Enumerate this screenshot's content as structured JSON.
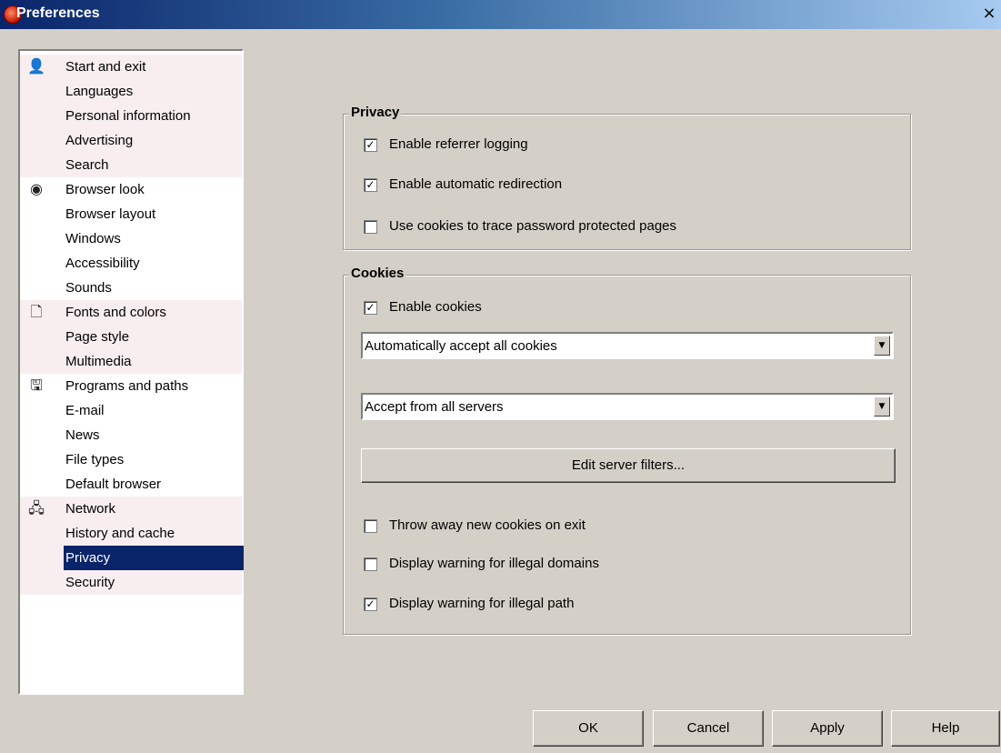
{
  "window": {
    "title": "Preferences",
    "close_glyph": "×"
  },
  "sidebar": {
    "items": [
      {
        "label": "Start and exit",
        "icon": "person-icon",
        "glyph": "👤"
      },
      {
        "label": "Languages"
      },
      {
        "label": "Personal information"
      },
      {
        "label": "Advertising"
      },
      {
        "label": "Search"
      },
      {
        "label": "Browser look",
        "icon": "eye-icon",
        "glyph": "◉"
      },
      {
        "label": "Browser layout"
      },
      {
        "label": "Windows"
      },
      {
        "label": "Accessibility"
      },
      {
        "label": "Sounds"
      },
      {
        "label": "Fonts and colors",
        "icon": "page-icon",
        "glyph": "🗋"
      },
      {
        "label": "Page style"
      },
      {
        "label": "Multimedia"
      },
      {
        "label": "Programs and paths",
        "icon": "floppy-disk-icon",
        "glyph": "🖫"
      },
      {
        "label": "E-mail"
      },
      {
        "label": "News"
      },
      {
        "label": "File types"
      },
      {
        "label": "Default browser"
      },
      {
        "label": "Network",
        "icon": "network-icon",
        "glyph": "🖧"
      },
      {
        "label": "History and cache"
      },
      {
        "label": "Privacy",
        "selected": true
      },
      {
        "label": "Security"
      }
    ]
  },
  "privacy": {
    "title": "Privacy",
    "options": [
      {
        "label": "Enable referrer logging",
        "checked": true
      },
      {
        "label": "Enable automatic redirection",
        "checked": true
      },
      {
        "label": "Use cookies to trace password protected pages",
        "checked": false
      }
    ]
  },
  "cookies": {
    "title": "Cookies",
    "enable": {
      "label": "Enable cookies",
      "checked": true
    },
    "accept_policy": {
      "value": "Automatically accept all cookies"
    },
    "server_policy": {
      "value": "Accept from all servers"
    },
    "edit_filters_label": "Edit server filters...",
    "options": [
      {
        "label": "Throw away new cookies on exit",
        "checked": false
      },
      {
        "label": "Display warning for illegal domains",
        "checked": false
      },
      {
        "label": "Display warning for illegal path",
        "checked": true
      }
    ]
  },
  "buttons": {
    "ok": "OK",
    "cancel": "Cancel",
    "apply": "Apply",
    "help": "Help"
  }
}
